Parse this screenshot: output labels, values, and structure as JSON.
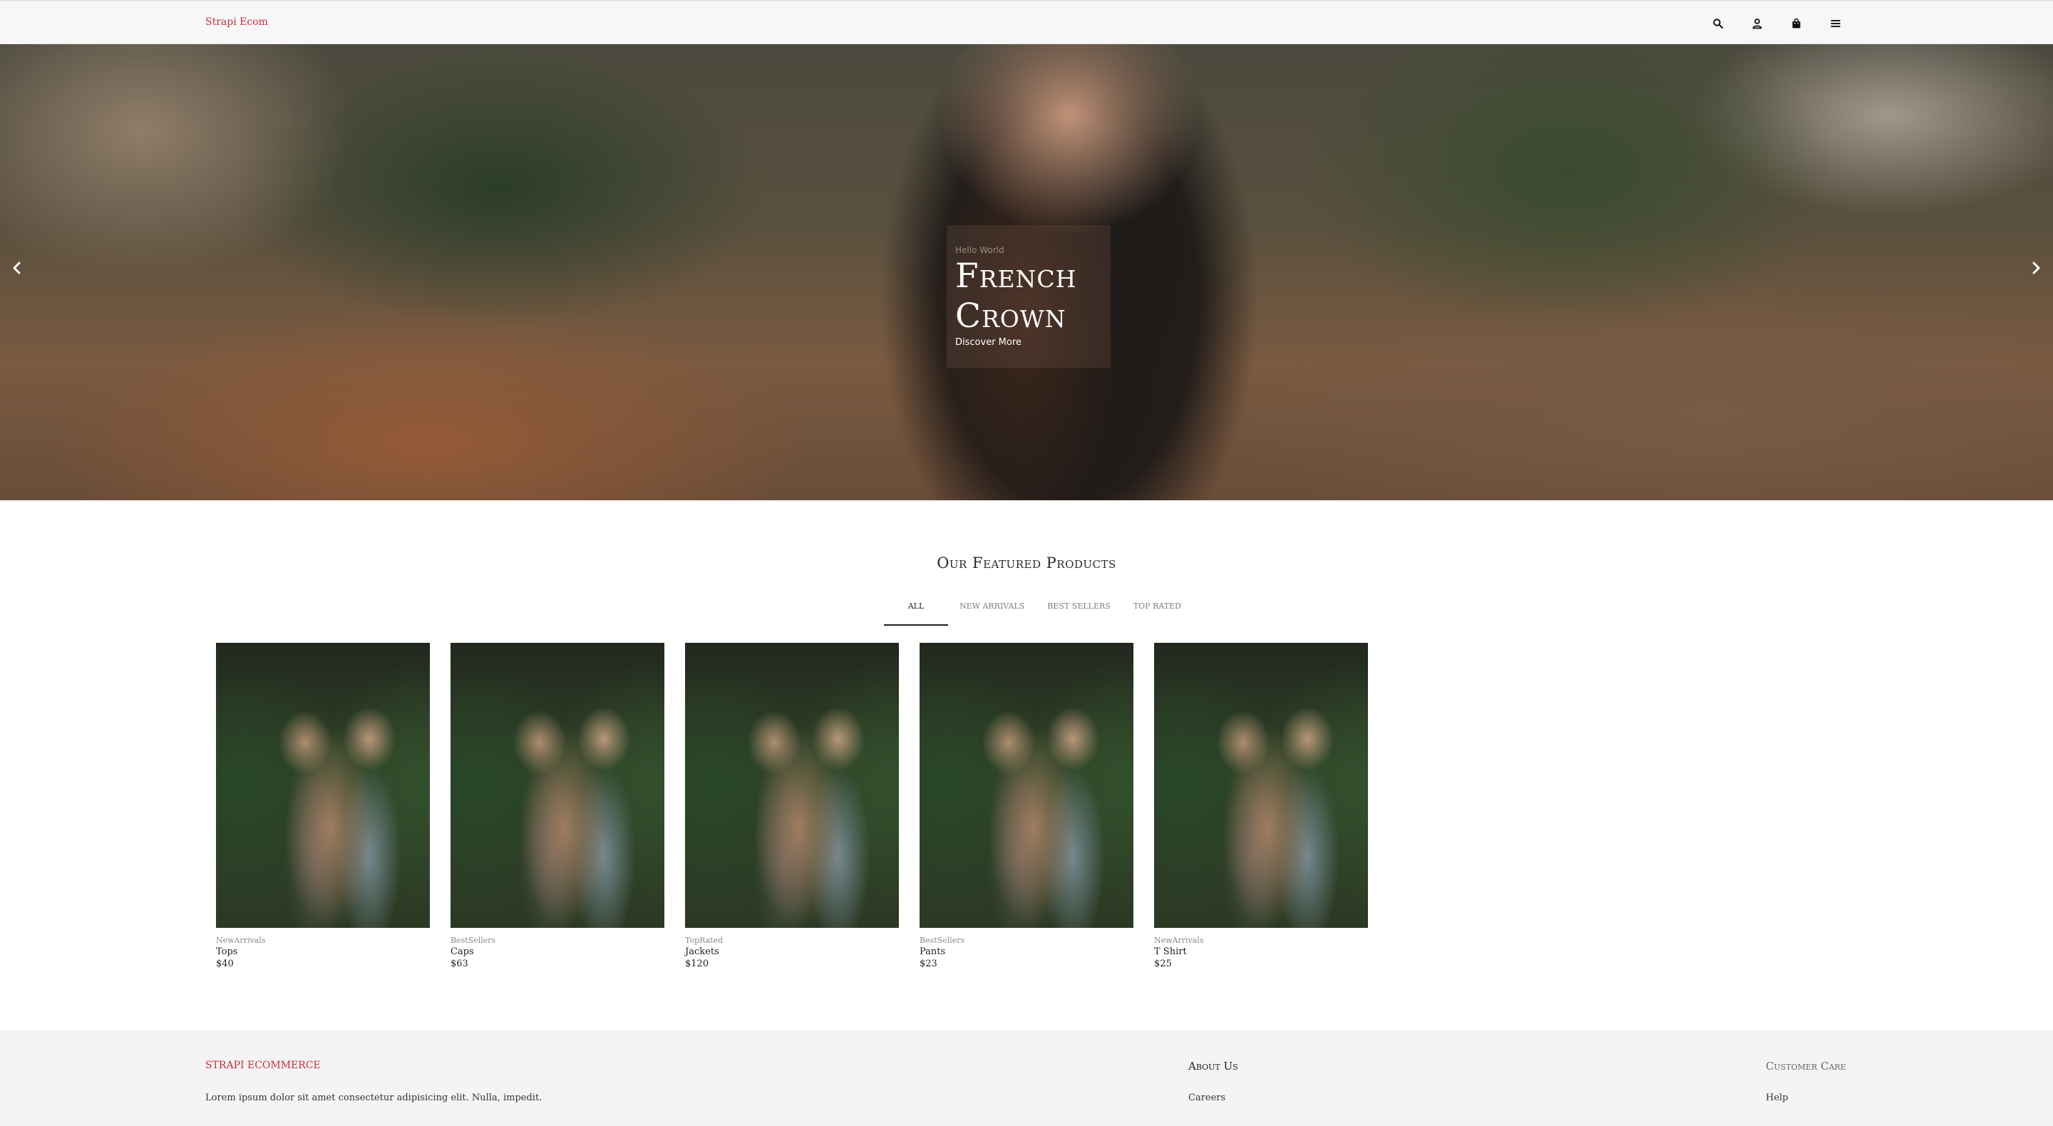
{
  "header": {
    "brand": "Strapi Ecom",
    "icons": [
      "search-icon",
      "user-icon",
      "bag-icon",
      "menu-icon"
    ]
  },
  "hero": {
    "eyebrow": "Hello World",
    "title": "French Crown",
    "cta": "Discover More"
  },
  "featured": {
    "title": "Our Featured Products",
    "tabs": [
      {
        "label": "All",
        "active": true
      },
      {
        "label": "New Arrivals",
        "active": false
      },
      {
        "label": "Best Sellers",
        "active": false
      },
      {
        "label": "Top Rated",
        "active": false
      }
    ],
    "products": [
      {
        "category": "NewArrivals",
        "name": "Tops",
        "price": "$40"
      },
      {
        "category": "BestSellers",
        "name": "Caps",
        "price": "$63"
      },
      {
        "category": "TopRated",
        "name": "Jackets",
        "price": "$120"
      },
      {
        "category": "BestSellers",
        "name": "Pants",
        "price": "$23"
      },
      {
        "category": "NewArrivals",
        "name": "T Shirt",
        "price": "$25"
      }
    ]
  },
  "footer": {
    "brand": "Strapi Ecommerce",
    "description": "Lorem ipsum dolor sit amet consectetur adipisicing elit. Nulla, impedit.",
    "about_title": "About Us",
    "about_link": "Careers",
    "care_title": "Customer Care",
    "care_link": "Help"
  },
  "colors": {
    "accent": "#c62f3a",
    "header_bg": "#f7f7f7",
    "footer_bg": "#f4f4f4"
  }
}
